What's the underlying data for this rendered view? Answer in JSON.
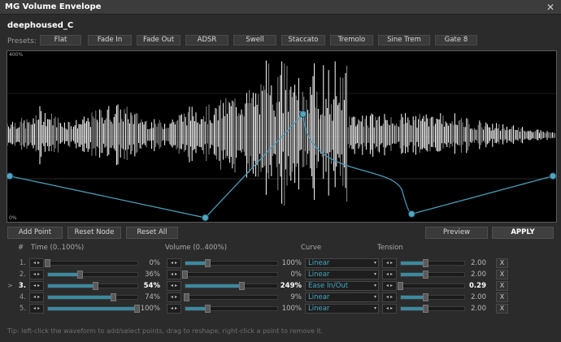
{
  "window": {
    "title": "MG Volume Envelope",
    "close_glyph": "✕"
  },
  "file": {
    "name": "deephoused_C"
  },
  "presets": {
    "label": "Presets:",
    "items": [
      "Flat",
      "Fade In",
      "Fade Out",
      "ADSR",
      "Swell",
      "Staccato",
      "Tremolo",
      "Sine Trem",
      "Gate 8"
    ]
  },
  "waveform": {
    "corner_top": "400%",
    "corner_bottom": "0%",
    "envelope_points": [
      {
        "time": 0,
        "volume": 100
      },
      {
        "time": 36,
        "volume": 0
      },
      {
        "time": 54,
        "volume": 249
      },
      {
        "time": 74,
        "volume": 9
      },
      {
        "time": 100,
        "volume": 100
      }
    ],
    "colors": {
      "wave": "#ffffff",
      "envelope": "#4a9bb8",
      "point": "#4fa6c4"
    }
  },
  "buttons": {
    "add_point": "Add Point",
    "reset_node": "Reset Node",
    "reset_all": "Reset All",
    "preview": "Preview",
    "apply": "APPLY"
  },
  "table": {
    "headers": {
      "index": "#",
      "time": "Time (0..100%)",
      "volume": "Volume (0..400%)",
      "curve": "Curve",
      "tension": "Tension"
    },
    "rows": [
      {
        "index": "1.",
        "time": "0%",
        "time_frac": 0.0,
        "volume": "100%",
        "volume_frac": 0.25,
        "curve": "Linear",
        "tension": "2.00",
        "tension_frac": 0.4,
        "selected": false,
        "delete": "X"
      },
      {
        "index": "2.",
        "time": "36%",
        "time_frac": 0.36,
        "volume": "0%",
        "volume_frac": 0.0,
        "curve": "Linear",
        "tension": "2.00",
        "tension_frac": 0.4,
        "selected": false,
        "delete": "X"
      },
      {
        "index": "3.",
        "time": "54%",
        "time_frac": 0.54,
        "volume": "249%",
        "volume_frac": 0.62,
        "curve": "Ease In/Out",
        "tension": "0.29",
        "tension_frac": 0.0,
        "selected": true,
        "delete": "X"
      },
      {
        "index": "4.",
        "time": "74%",
        "time_frac": 0.74,
        "volume": "9%",
        "volume_frac": 0.02,
        "curve": "Linear",
        "tension": "2.00",
        "tension_frac": 0.4,
        "selected": false,
        "delete": "X"
      },
      {
        "index": "5.",
        "time": "100%",
        "time_frac": 1.0,
        "volume": "100%",
        "volume_frac": 0.25,
        "curve": "Linear",
        "tension": "2.00",
        "tension_frac": 0.4,
        "selected": false,
        "delete": "X"
      }
    ],
    "selected_marker": ">",
    "stepper_glyph": "◂ ▸",
    "dropdown_glyph": "▾"
  },
  "tip": "Tip: left-click the waveform to add/select points, drag to reshape, right-click a point to remove it."
}
